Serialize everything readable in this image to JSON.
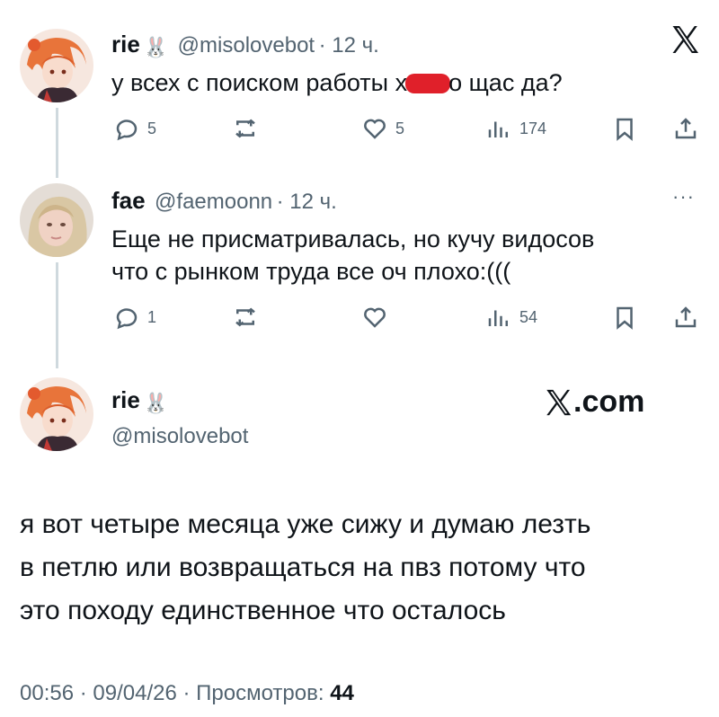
{
  "tweet1": {
    "name": "rie",
    "name_emoji": "🐰",
    "handle": "@misolovebot",
    "time": "· 12 ч.",
    "text_before": "у всех с поиском работы х",
    "text_after": "о щас да?",
    "redaction_color": "#e0202a",
    "replies": "5",
    "reposts": "",
    "likes": "5",
    "views": "174"
  },
  "tweet2": {
    "name": "fae",
    "handle": "@faemoonn",
    "time": "· 12 ч.",
    "more": "···",
    "text_line1": "Еще не присматривалась, но кучу видосов",
    "text_line2": "что с рынком труда все оч плохо:(((",
    "replies": "1",
    "likes": "",
    "views": "54"
  },
  "main": {
    "name": "rie",
    "name_emoji": "🐰",
    "handle": "@misolovebot",
    "brand": ".com",
    "text_line1": "я вот четыре месяца уже сижу и думаю лезть",
    "text_line2": "в петлю или возвращаться на пвз потому что",
    "text_line3": "это походу единственное что осталось",
    "timestamp": "00:56 · 09/04/26 · Просмотров:",
    "views": "44"
  },
  "icons": {
    "x_logo": "x-logo-icon",
    "reply": "reply-icon",
    "repost": "repost-icon",
    "like": "heart-icon",
    "views": "views-icon",
    "bookmark": "bookmark-icon",
    "share": "share-icon"
  },
  "colors": {
    "text": "#0f1419",
    "muted": "#536471",
    "thread_line": "#cfd9de"
  }
}
